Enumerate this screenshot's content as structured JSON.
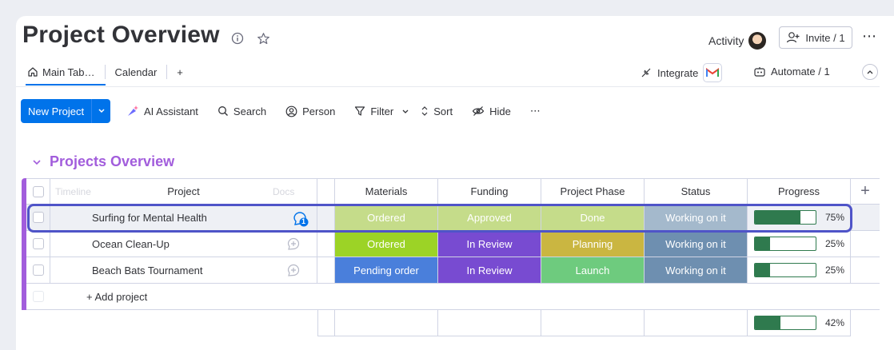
{
  "header": {
    "title": "Project Overview",
    "activity_label": "Activity",
    "invite_label": "Invite / 1",
    "more_glyph": "⋯"
  },
  "tabs": [
    {
      "label": "Main Tab…",
      "icon": "home-icon"
    },
    {
      "label": "Calendar"
    },
    {
      "label": "+"
    }
  ],
  "integrations": {
    "integrate_label": "Integrate",
    "automate_label": "Automate / 1",
    "logo_letter": "M",
    "collapse_glyph": "⌃"
  },
  "toolbar": {
    "new_label": "New Project",
    "ai_label": "AI Assistant",
    "search_label": "Search",
    "person_label": "Person",
    "filter_label": "Filter",
    "sort_label": "Sort",
    "hide_label": "Hide",
    "more_glyph": "⋯"
  },
  "group": {
    "title": "Projects Overview",
    "chevron": "⌄"
  },
  "table": {
    "headers": {
      "project": "Project",
      "materials": "Materials",
      "funding": "Funding",
      "phase": "Project Phase",
      "status": "Status",
      "progress": "Progress",
      "add_column": "+"
    },
    "ghost_labels": {
      "timeline": "Timeline",
      "docs": "Docs"
    },
    "rows": [
      {
        "name": "Surfing for Mental Health",
        "materials": "Ordered",
        "funding": "Approved",
        "phase": "Done",
        "status": "Working on it",
        "progress_label": "75%",
        "progress": 0.75,
        "update_count": "1"
      },
      {
        "name": "Ocean Clean-Up",
        "materials": "Ordered",
        "funding": "In Review",
        "phase": "Planning",
        "status": "Working on it",
        "progress_label": "25%",
        "progress": 0.25
      },
      {
        "name": "Beach Bats Tournament",
        "materials": "Pending order",
        "funding": "In Review",
        "phase": "Launch",
        "status": "Working on it",
        "progress_label": "25%",
        "progress": 0.25
      }
    ],
    "add_row_label": "+ Add project",
    "summary": {
      "progress_label": "42%",
      "progress": 0.42
    }
  },
  "colors": {
    "accent": "#0073ea",
    "group": "#a25ddc",
    "ordered": "#9cd326",
    "approved": "#9cd326",
    "done": "#00c875",
    "working": "#6e8fb0",
    "in_review": "#784bd1",
    "planning": "#cab641",
    "launch": "#00c875",
    "pending": "#4a7fdb",
    "progress": "#2f7a4e",
    "selection": "#4f54c8"
  }
}
